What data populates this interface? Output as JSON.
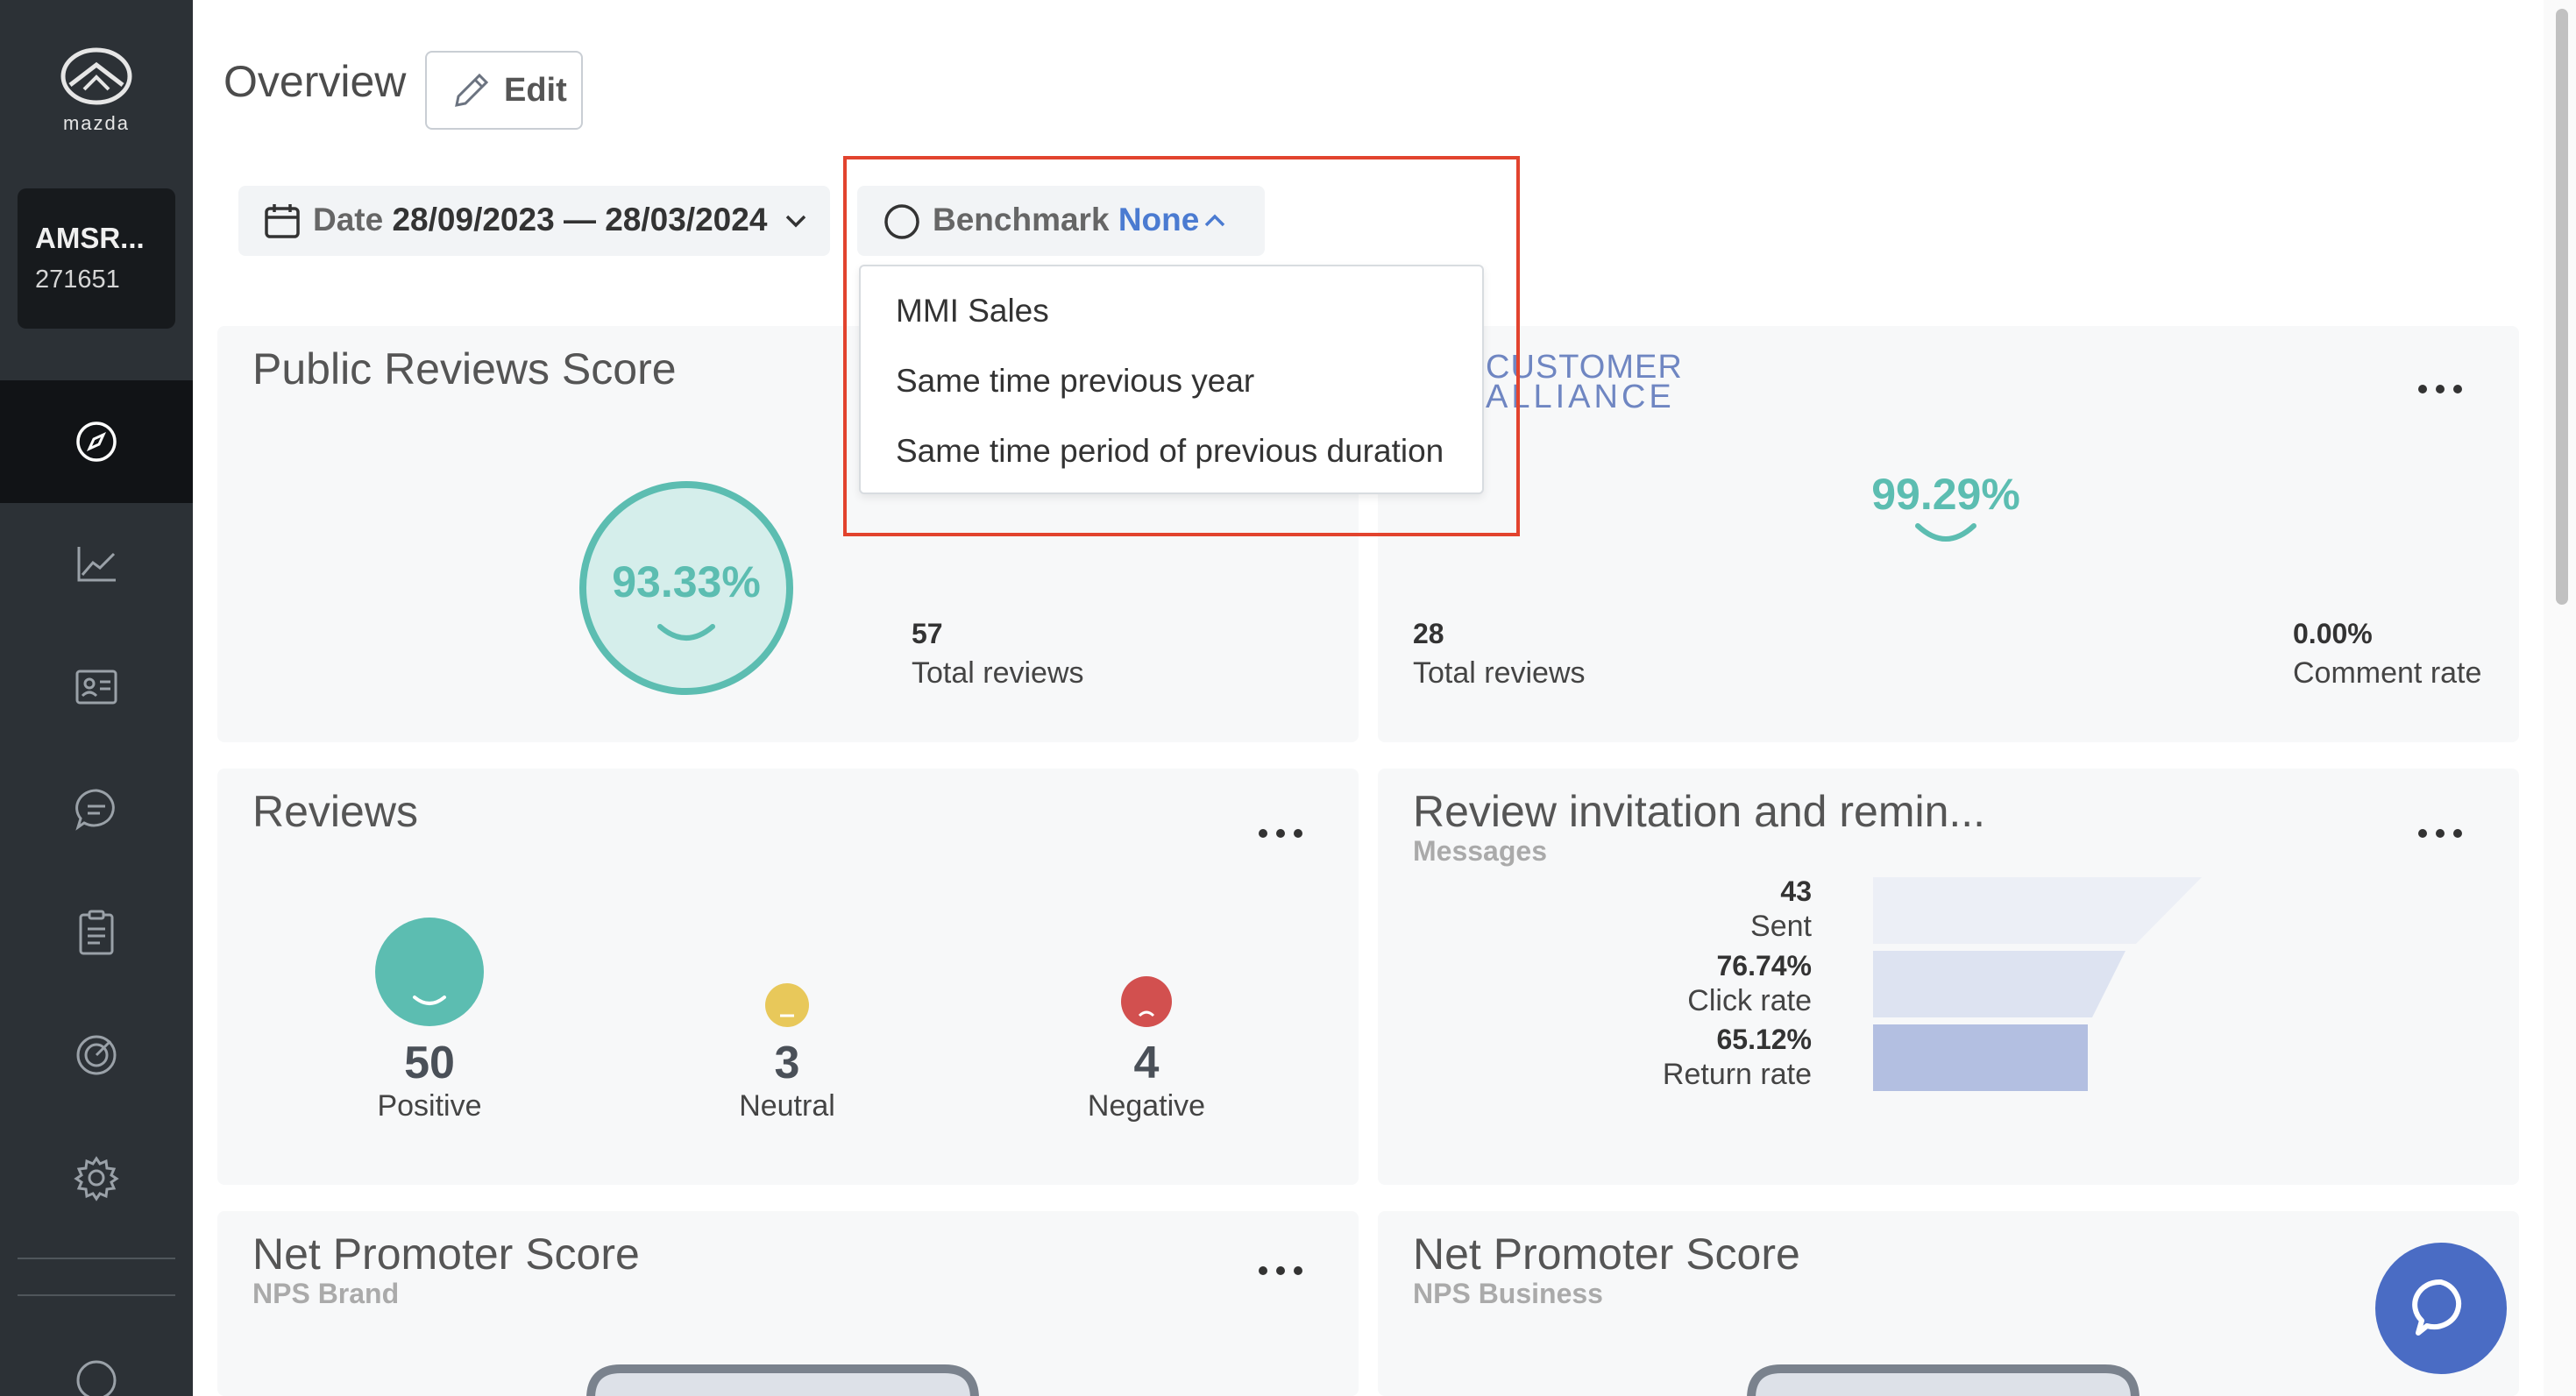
{
  "brand": {
    "logo_text": "mazda"
  },
  "account": {
    "name": "AMSR...",
    "id": "271651"
  },
  "sidebar": {
    "items": [
      {
        "name": "compass-icon",
        "active": true
      },
      {
        "name": "chart-line-icon"
      },
      {
        "name": "contact-card-icon"
      },
      {
        "name": "chat-bubble-icon"
      },
      {
        "name": "clipboard-icon"
      },
      {
        "name": "target-icon"
      },
      {
        "name": "gear-icon"
      },
      {
        "name": "help-icon"
      }
    ]
  },
  "header": {
    "title": "Overview",
    "edit_label": "Edit"
  },
  "filters": {
    "date_label": "Date",
    "date_value": "28/09/2023 — 28/03/2024",
    "benchmark_label": "Benchmark",
    "benchmark_value": "None",
    "benchmark_options": [
      "MMI Sales",
      "Same time previous year",
      "Same time period of previous duration"
    ]
  },
  "public_reviews": {
    "title": "Public Reviews Score",
    "score": "93.33%",
    "score_fraction": 0.9333,
    "total_reviews": "57",
    "total_reviews_label": "Total reviews"
  },
  "customer_alliance": {
    "logo_line1": "CUSTOMER",
    "logo_line2": "ALLIANCE",
    "score": "99.29%",
    "total_reviews": "28",
    "total_reviews_label": "Total reviews",
    "comment_rate": "0.00%",
    "comment_rate_label": "Comment rate"
  },
  "reviews": {
    "title": "Reviews",
    "positive": "50",
    "positive_label": "Positive",
    "neutral": "3",
    "neutral_label": "Neutral",
    "negative": "4",
    "negative_label": "Negative",
    "colors": {
      "positive": "#5cbdb1",
      "neutral": "#e8c85a",
      "negative": "#d2504f"
    }
  },
  "invitations": {
    "title": "Review invitation and remin...",
    "subtitle": "Messages",
    "sent": "43",
    "sent_label": "Sent",
    "click_rate": "76.74%",
    "click_rate_label": "Click rate",
    "return_rate": "65.12%",
    "return_rate_label": "Return rate"
  },
  "nps_brand": {
    "title": "Net Promoter Score",
    "subtitle": "NPS Brand"
  },
  "nps_business": {
    "title": "Net Promoter Score",
    "subtitle": "NPS Business"
  },
  "colors": {
    "accent": "#4b7bd1",
    "teal": "#5cbdb1",
    "sidebar": "#2c3136",
    "highlight": "#e2432e"
  }
}
